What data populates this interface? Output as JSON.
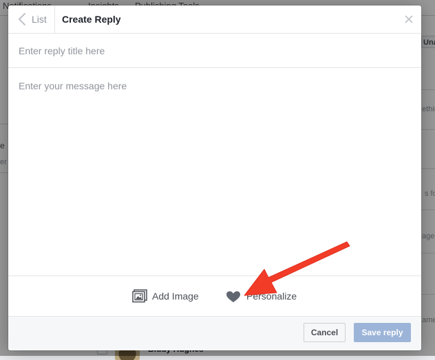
{
  "background": {
    "nav_tabs": [
      "Notifications",
      "Insights",
      "Publishing Tools"
    ],
    "right_button_label": "Unan",
    "right_snippets": [
      "ethin",
      "s for",
      "age",
      "ame"
    ],
    "left_snippets": [
      "e",
      "er"
    ],
    "row_name": "Biddy Hughes"
  },
  "dialog": {
    "back_label": "List",
    "title": "Create Reply",
    "close_symbol": "×",
    "title_placeholder": "Enter reply title here",
    "message_placeholder": "Enter your message here",
    "tools": {
      "add_image_label": "Add Image",
      "personalize_label": "Personalize"
    },
    "footer": {
      "cancel_label": "Cancel",
      "save_label": "Save reply"
    }
  },
  "colors": {
    "annotation_arrow": "#f23c28",
    "save_button_disabled": "#9cb4d8",
    "icon_gray": "#4b4f56",
    "heart_gray": "#606770"
  },
  "icons": [
    "chevron-left-icon",
    "close-icon",
    "image-icon",
    "heart-icon"
  ]
}
